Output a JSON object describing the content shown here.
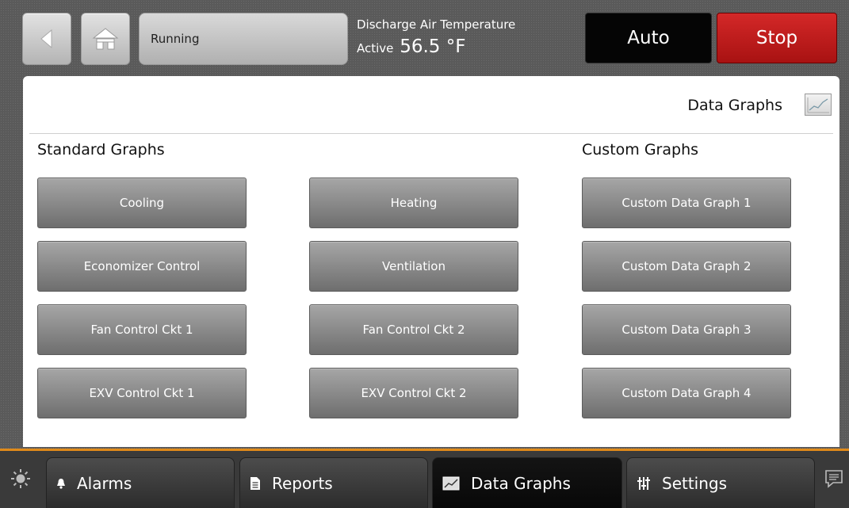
{
  "header": {
    "status": "Running",
    "point_label": "Discharge Air Temperature",
    "point_state": "Active",
    "point_value": "56.5 °F",
    "auto_label": "Auto",
    "stop_label": "Stop"
  },
  "panel": {
    "title": "Data Graphs",
    "standard_heading": "Standard Graphs",
    "custom_heading": "Custom Graphs",
    "standard_col1": [
      "Cooling",
      "Economizer Control",
      "Fan Control Ckt 1",
      "EXV Control Ckt 1"
    ],
    "standard_col2": [
      "Heating",
      "Ventilation",
      "Fan Control Ckt 2",
      "EXV Control Ckt 2"
    ],
    "custom": [
      "Custom Data Graph 1",
      "Custom Data Graph 2",
      "Custom Data Graph 3",
      "Custom Data Graph 4"
    ]
  },
  "nav": {
    "tabs": [
      {
        "label": "Alarms",
        "icon": "bell-icon"
      },
      {
        "label": "Reports",
        "icon": "document-icon"
      },
      {
        "label": "Data Graphs",
        "icon": "chart-icon"
      },
      {
        "label": "Settings",
        "icon": "sliders-icon"
      }
    ],
    "active_tab": "Data Graphs"
  },
  "colors": {
    "stop": "#c21d1d",
    "auto": "#050505",
    "accent_line": "#e08a1a",
    "button_gray": "#8a8a8a"
  }
}
